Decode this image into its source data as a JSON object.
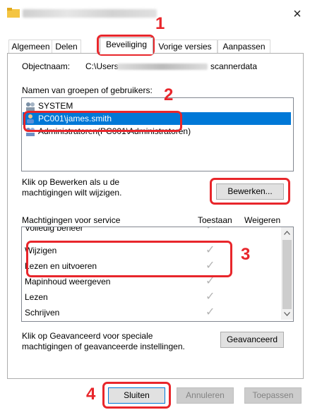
{
  "window": {
    "close_glyph": "×"
  },
  "tabs": [
    {
      "label": "Algemeen"
    },
    {
      "label": "Delen"
    },
    {
      "label": "Beveiliging"
    },
    {
      "label": "Vorige versies"
    },
    {
      "label": "Aanpassen"
    }
  ],
  "object": {
    "label": "Objectnaam:",
    "path_prefix": "C:\\Users",
    "path_suffix": "scannerdata"
  },
  "groups": {
    "label": "Namen van groepen of gebruikers:",
    "items": [
      {
        "label": "SYSTEM"
      },
      {
        "label": "PC001\\james.smith"
      },
      {
        "label": "Administratoren(PC001\\Administratoren)"
      }
    ]
  },
  "edit": {
    "hint": "Klik op Bewerken als u de machtigingen wilt wijzigen.",
    "hint_line1": "Klik op Bewerken als u de",
    "hint_line2": "machtigingen wilt wijzigen.",
    "button": "Bewerken..."
  },
  "permissions": {
    "label": "Machtigingen voor service",
    "col_allow": "Toestaan",
    "col_deny": "Weigeren",
    "rows": [
      {
        "label": "Volledig beheer",
        "allow": true
      },
      {
        "label": "Wijzigen",
        "allow": true
      },
      {
        "label": "Lezen en uitvoeren",
        "allow": true
      },
      {
        "label": "Mapinhoud weergeven",
        "allow": true
      },
      {
        "label": "Lezen",
        "allow": true
      },
      {
        "label": "Schrijven",
        "allow": true
      }
    ],
    "check_glyph": "✓"
  },
  "advanced": {
    "hint_line1": "Klik op Geavanceerd voor speciale",
    "hint_line2": "machtigingen of geavanceerde instellingen.",
    "button": "Geavanceerd"
  },
  "footer": {
    "close": "Sluiten",
    "cancel": "Annuleren",
    "apply": "Toepassen"
  },
  "callouts": {
    "n1": "1",
    "n2": "2",
    "n3": "3",
    "n4": "4"
  },
  "colors": {
    "callout": "#e8262b",
    "selection": "#0078d7"
  }
}
